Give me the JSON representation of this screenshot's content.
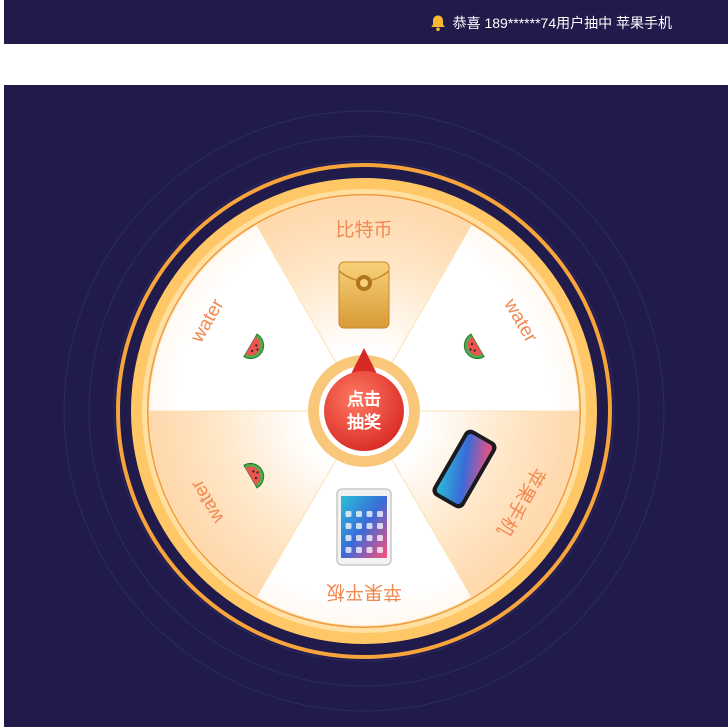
{
  "notice": {
    "icon": "bell-icon",
    "text": "恭喜 189******74用户抽中 苹果手机"
  },
  "wheel": {
    "segments": [
      {
        "label": "比特币",
        "icon": "red-envelope-icon"
      },
      {
        "label": "water",
        "icon": "watermelon-icon"
      },
      {
        "label": "苹果手机",
        "icon": "smartphone-icon"
      },
      {
        "label": "苹果平板",
        "icon": "tablet-icon"
      },
      {
        "label": "water",
        "icon": "watermelon-icon"
      },
      {
        "label": "water",
        "icon": "watermelon-icon"
      }
    ],
    "button": {
      "line1": "点击",
      "line2": "抽奖"
    }
  },
  "colors": {
    "background": "#201b4b",
    "rim": "#ffc766",
    "rim_stroke": "#f7a43c",
    "segment_warm": "#ffd7a8",
    "segment_white": "#ffffff",
    "label": "#f08a52",
    "button": "#e8382f"
  }
}
